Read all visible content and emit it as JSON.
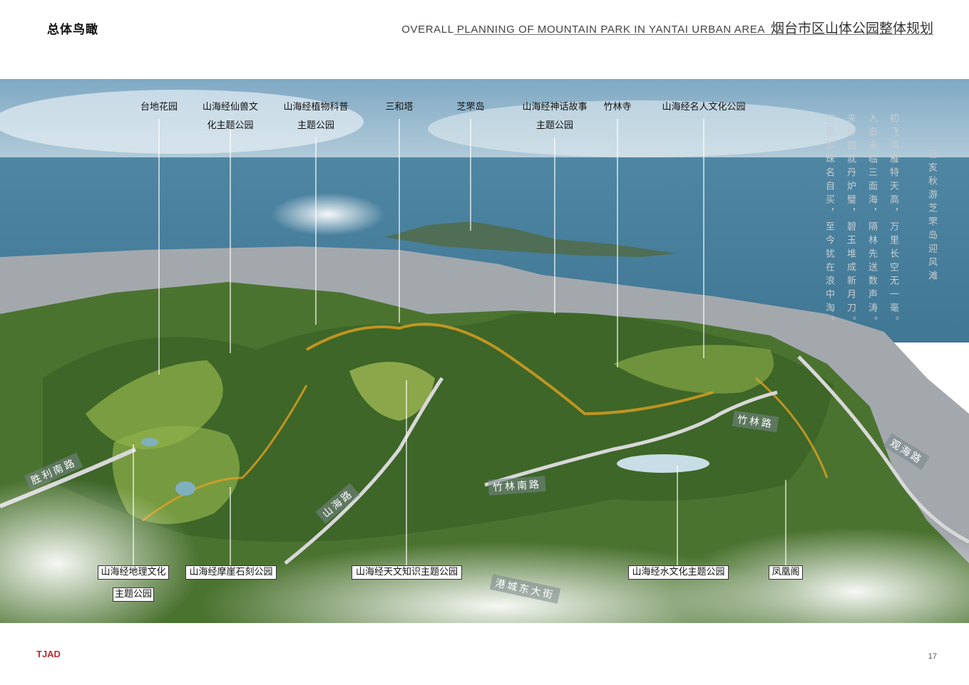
{
  "header": {
    "title_cn": "总体鸟瞰",
    "subtitle_en": "OVERALL PLANNING OF MOUNTAIN PARK IN YANTAI URBAN AREA",
    "subtitle_cn": "烟台市区山体公园整体规划"
  },
  "labels_top": [
    {
      "line1": "台地花园",
      "line2": ""
    },
    {
      "line1": "山海经仙兽文",
      "line2": "化主题公园"
    },
    {
      "line1": "山海经植物科普",
      "line2": "主题公园"
    },
    {
      "line1": "三和塔",
      "line2": ""
    },
    {
      "line1": "芝罘岛",
      "line2": ""
    },
    {
      "line1": "山海经神话故事",
      "line2": "主题公园"
    },
    {
      "line1": "竹林寺",
      "line2": ""
    },
    {
      "line1": "山海经名人文化公园",
      "line2": ""
    }
  ],
  "labels_bottom": [
    {
      "line1": "山海经地理文化",
      "line2": "主题公园"
    },
    {
      "line1": "山海经摩崖石刻公园",
      "line2": ""
    },
    {
      "line1": "山海经天文知识主题公园",
      "line2": ""
    },
    {
      "line1": "山海经水文化主题公园",
      "line2": ""
    },
    {
      "line1": "凤凰阁",
      "line2": ""
    }
  ],
  "roads": {
    "shengli": "胜利南路",
    "shanhai": "山海路",
    "zhulinnan": "竹林南路",
    "zhulin": "竹林路",
    "guanhai": "观海路",
    "gangcheng": "港城东大街"
  },
  "poem": {
    "title": "己亥秋游芝罘岛迎风滩",
    "col1": "初飞鸿雁特天高，万里长空无一毫。",
    "col2": "入岛未临三面海，隔林先送数声涛。",
    "col3": "来砂圆就丹炉璧，碧玉堆成新月刀。",
    "col4": "岂是珍珠名自买，至今犹在浪中淘。"
  },
  "footer": {
    "logo": "TJAD",
    "page": "17"
  },
  "colors": {
    "sea": "#5b8fa8",
    "forest": "#3f6a2a",
    "city": "#a9adb2",
    "accent_path": "#e0a020",
    "logo": "#c0282d"
  }
}
